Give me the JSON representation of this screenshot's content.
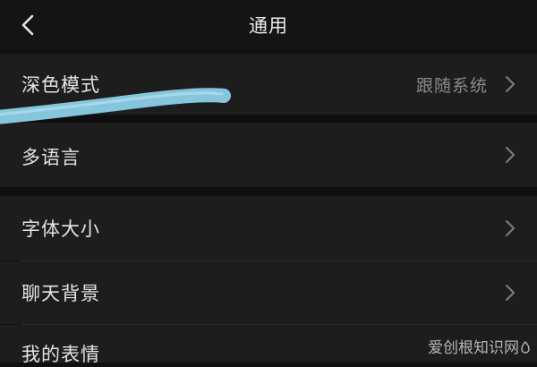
{
  "header": {
    "title": "通用",
    "back_icon": "chevron-left-icon"
  },
  "settings": [
    {
      "label": "深色模式",
      "value": "跟随系统",
      "icon": "chevron-right-icon"
    },
    {
      "label": "多语言",
      "icon": "chevron-right-icon"
    },
    {
      "label": "字体大小",
      "icon": "chevron-right-icon"
    },
    {
      "label": "聊天背景",
      "icon": "chevron-right-icon"
    },
    {
      "label": "我的表情",
      "icon": "chevron-right-icon"
    }
  ],
  "watermark": {
    "text": "爱创根知识网"
  },
  "colors": {
    "background": "#101010",
    "row": "#1d1d1d",
    "text": "#e4e4e4",
    "secondary_text": "#8a8a8a",
    "scribble": "#86c6dd"
  }
}
